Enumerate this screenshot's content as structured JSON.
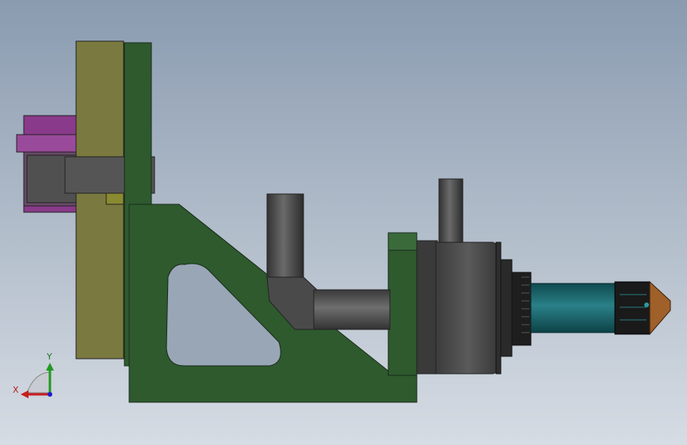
{
  "triad": {
    "x_label": "X",
    "y_label": "Y",
    "colors": {
      "x": "#c81e1e",
      "y": "#1e9a1e",
      "z": "#1e1ec8"
    }
  },
  "part_colors": {
    "olive_plate": "#7a7a40",
    "green_frame": "#2e5a2e",
    "magenta_block": "#8a3a8a",
    "gray_body": "#4a4a4a",
    "teal_shaft": "#1e6a6e",
    "copper_tip": "#a0602a"
  }
}
